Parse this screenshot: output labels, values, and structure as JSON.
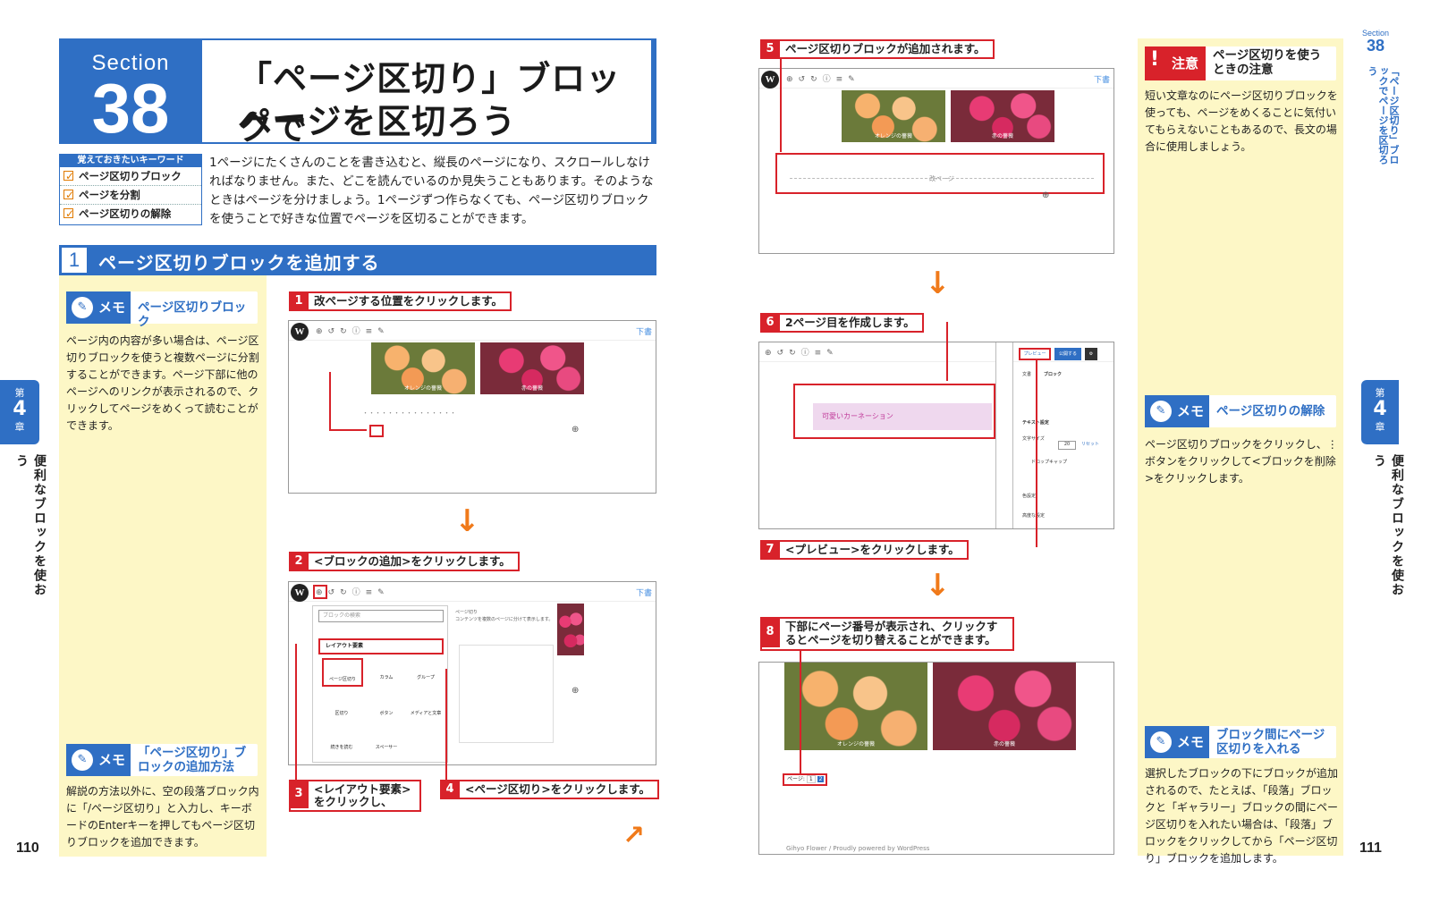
{
  "section": {
    "label": "Section",
    "number": "38"
  },
  "title": {
    "line1": "「ページ区切り」ブロックで",
    "line2": "ページを区切ろう"
  },
  "keywords": {
    "heading": "覚えておきたいキーワード",
    "items": [
      "ページ区切りブロック",
      "ページを分割",
      "ページ区切りの解除"
    ]
  },
  "intro": "1ページにたくさんのことを書き込むと、縦長のページになり、スクロールしなければなりません。また、どこを読んでいるのか見失うこともあります。そのようなときはページを分けましょう。1ページずつ作らなくても、ページ区切りブロックを使うことで好きな位置でページを区切ることができます。",
  "heading1": {
    "number": "1",
    "text": "ページ区切りブロックを追加する"
  },
  "memo_label": "メモ",
  "left_memos": [
    {
      "title": "ページ区切りブロック",
      "body": "ページ内の内容が多い場合は、ページ区切りブロックを使うと複数ページに分割することができます。ページ下部に他のページへのリンクが表示されるので、クリックしてページをめくって読むことができます。"
    },
    {
      "title": "「ページ区切り」ブロックの追加方法",
      "body": "解説の方法以外に、空の段落ブロック内に「/ページ区切り」と入力し、キーボードのEnterキーを押してもページ区切りブロックを追加できます。"
    }
  ],
  "steps": {
    "s1": {
      "n": "1",
      "text": "改ページする位置をクリックします。"
    },
    "s2": {
      "n": "2",
      "text": "<ブロックの追加>をクリックします。"
    },
    "s3": {
      "n": "3",
      "text": "<レイアウト要素>をクリックし、"
    },
    "s4": {
      "n": "4",
      "text": "<ページ区切り>をクリックします。"
    },
    "s5": {
      "n": "5",
      "text": "ページ区切りブロックが追加されます。"
    },
    "s6": {
      "n": "6",
      "text": "2ページ目を作成します。"
    },
    "s7": {
      "n": "7",
      "text": "<プレビュー>をクリックします。"
    },
    "s8": {
      "n": "8",
      "text": "下部にページ番号が表示され、クリックするとページを切り替えることができます。"
    }
  },
  "shots": {
    "caption_orange": "オレンジの薔薇",
    "caption_red": "赤の薔薇",
    "draft": "下書",
    "search_placeholder": "ブロックの検索",
    "layout_elements": "レイアウト要素",
    "block_items": [
      "ページ区切り",
      "カラム",
      "グループ",
      "区切り",
      "ボタン",
      "メディアと文章",
      "続きを読む",
      "スペーサー"
    ],
    "page_break_desc_title": "ページ切り",
    "page_break_desc": "コンテンツを複数のページに分けて表示します。",
    "page_break_label": "改ページ",
    "pink_text": "可愛いカーネーション",
    "preview": "プレビュー",
    "publish": "公開する",
    "panel_tabs": [
      "文書",
      "ブロック"
    ],
    "panel_text_settings": "テキスト設定",
    "panel_font_size": "文字サイズ",
    "panel_font_value": "20",
    "panel_reset": "リセット",
    "panel_dropcap": "ドロップキャップ",
    "panel_color": "色設定",
    "panel_advanced": "高度な設定",
    "pager_label": "ページ:",
    "pager_pages": [
      "1",
      "2"
    ],
    "footer": "Gihyo Flower / Proudly powered by WordPress"
  },
  "right_caution": {
    "label": "注意",
    "title": "ページ区切りを使うときの注意",
    "body": "短い文章なのにページ区切りブロックを使っても、ページをめくることに気付いてもらえないこともあるので、長文の場合に使用しましょう。"
  },
  "right_memos": [
    {
      "title": "ページ区切りの解除",
      "body": "ページ区切りブロックをクリックし、⋮ボタンをクリックして<ブロックを削除>をクリックします。"
    },
    {
      "title": "ブロック間にページ区切りを入れる",
      "body": "選択したブロックの下にブロックが追加されるので、たとえば、「段落」ブロックと「ギャラリー」ブロックの間にページ区切りを入れたい場合は、「段落」ブロックをクリックしてから「ページ区切り」ブロックを追加します。"
    }
  ],
  "chapter": {
    "label_top": "第",
    "number": "4",
    "label_bottom": "章",
    "title": "便利なブロックを使おう"
  },
  "right_side_section": {
    "label": "Section",
    "number": "38",
    "title": "「ページ区切り」ブロックでページを区切ろう"
  },
  "page_numbers": {
    "left": "110",
    "right": "111"
  }
}
